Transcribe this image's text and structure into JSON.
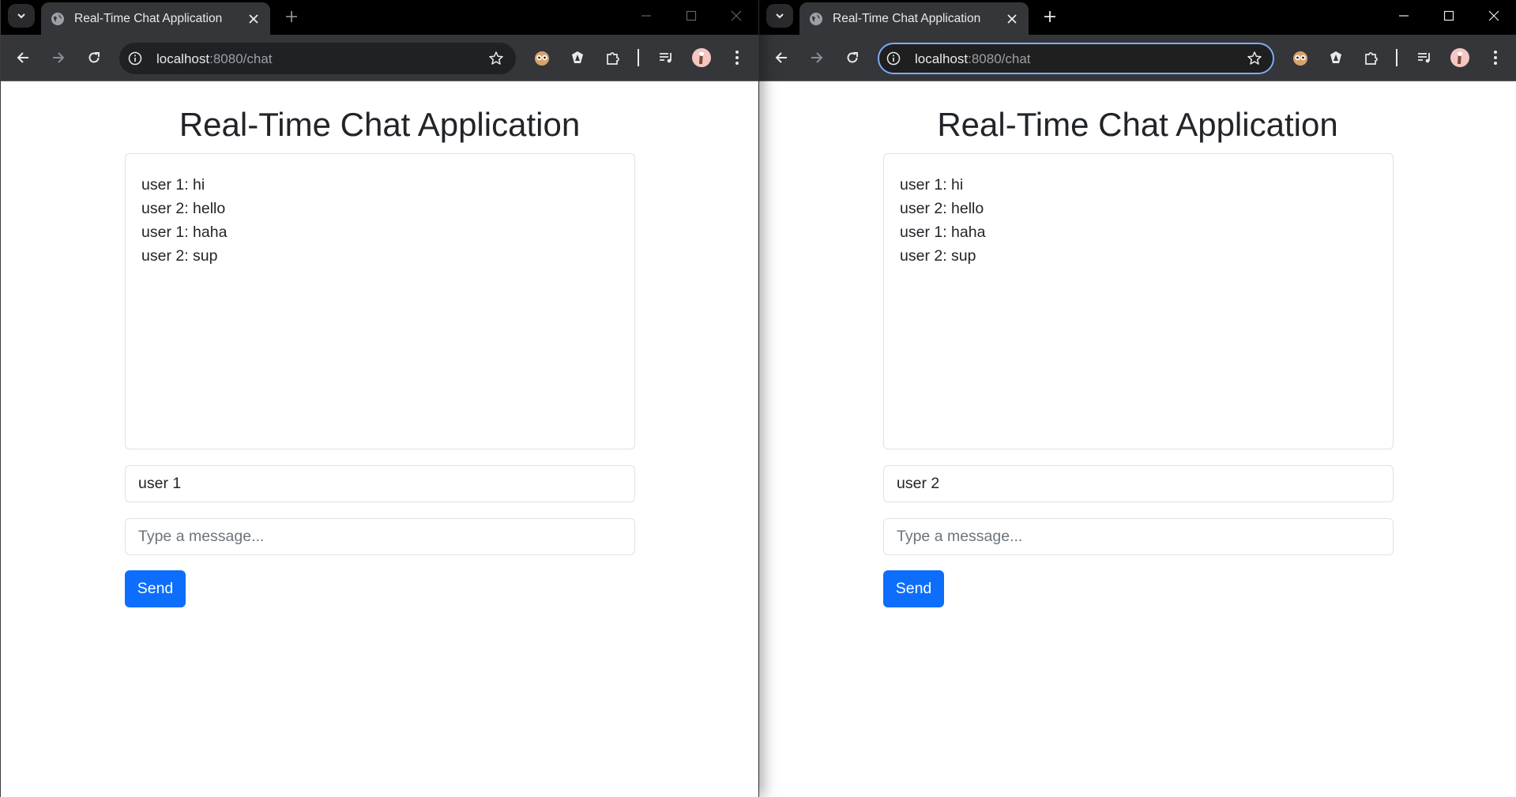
{
  "windows": [
    {
      "tab_title": "Real-Time Chat Application",
      "url_host": "localhost",
      "url_rest": ":8080/chat",
      "page_title": "Real-Time Chat Application",
      "messages": [
        "user 1: hi",
        "user 2: hello",
        "user 1: haha",
        "user 2: sup"
      ],
      "username_value": "user 1",
      "message_placeholder": "Type a message...",
      "send_label": "Send"
    },
    {
      "tab_title": "Real-Time Chat Application",
      "url_host": "localhost",
      "url_rest": ":8080/chat",
      "page_title": "Real-Time Chat Application",
      "messages": [
        "user 1: hi",
        "user 2: hello",
        "user 1: haha",
        "user 2: sup"
      ],
      "username_value": "user 2",
      "message_placeholder": "Type a message...",
      "send_label": "Send"
    }
  ],
  "icons": {
    "tab_list": "chevron-down-icon",
    "favicon": "globe-icon",
    "tab_close": "close-icon",
    "new_tab": "plus-icon",
    "back": "arrow-left-icon",
    "forward": "arrow-right-icon",
    "reload": "reload-icon",
    "site_info": "info-icon",
    "bookmark": "star-icon",
    "extension_1": "owl-extension-icon",
    "extension_2": "shield-extension-icon",
    "extensions": "puzzle-icon",
    "media": "media-controls-icon",
    "profile": "avatar",
    "menu": "kebab-menu-icon"
  },
  "colors": {
    "chrome_dark": "#35363a",
    "tabstrip": "#000000",
    "primary_button": "#0d6efd",
    "focus_ring": "#7cacf8"
  }
}
